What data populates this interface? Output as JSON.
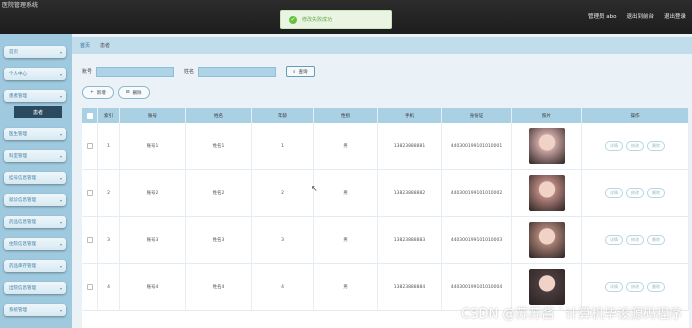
{
  "header": {
    "title": "医院管理系统",
    "user": "管理员 abo",
    "exit_frontend": "退出到前台",
    "logout": "退出登录"
  },
  "toast": {
    "message": "修改失败成功"
  },
  "sidebar": {
    "items": [
      {
        "label": "首页"
      },
      {
        "label": "个人中心"
      },
      {
        "label": "患者管理"
      },
      {
        "label": "医生管理"
      },
      {
        "label": "科室管理"
      },
      {
        "label": "挂号信息管理"
      },
      {
        "label": "就诊信息管理"
      },
      {
        "label": "药品信息管理"
      },
      {
        "label": "住院信息管理"
      },
      {
        "label": "药品库存管理"
      },
      {
        "label": "出院信息管理"
      },
      {
        "label": "系统管理"
      }
    ],
    "active_sub": "患者"
  },
  "breadcrumb": {
    "home": "首页",
    "current": "患者"
  },
  "search": {
    "label1": "账号",
    "label2": "姓名",
    "button": "查询"
  },
  "actions": {
    "add": "新增",
    "delete": "删除"
  },
  "table": {
    "columns": [
      "索引",
      "账号",
      "姓名",
      "年龄",
      "性别",
      "手机",
      "身份证",
      "照片",
      "操作"
    ],
    "op_labels": [
      "详情",
      "修改",
      "删除"
    ],
    "rows": [
      {
        "idx": "1",
        "account": "账号1",
        "name": "姓名1",
        "age": "1",
        "sex": "男",
        "phone": "13823888881",
        "idcard": "440300199101010001",
        "photo_color": "#c9a4a2"
      },
      {
        "idx": "2",
        "account": "账号2",
        "name": "姓名2",
        "age": "2",
        "sex": "男",
        "phone": "13823888882",
        "idcard": "440300199101010002",
        "photo_color": "#b7867f"
      },
      {
        "idx": "3",
        "account": "账号3",
        "name": "姓名3",
        "age": "3",
        "sex": "男",
        "phone": "13823888883",
        "idcard": "440300199101010003",
        "photo_color": "#a88074"
      },
      {
        "idx": "4",
        "account": "账号4",
        "name": "姓名4",
        "age": "4",
        "sex": "男",
        "phone": "13823888884",
        "idcard": "440300199101010004",
        "photo_color": "#4a3c3c"
      }
    ]
  },
  "watermark": "CSDN @苏苏酱 `计算机毕设源码程序",
  "colors": {
    "accent": "#a9d0e3",
    "sidebar": "#9ec9de",
    "toast_green": "#67c23a"
  },
  "icons": {
    "toast": "check-circle-icon",
    "search": "search-icon",
    "add": "plus-icon",
    "delete": "delete-icon",
    "chevron": "chevron-down-icon"
  }
}
